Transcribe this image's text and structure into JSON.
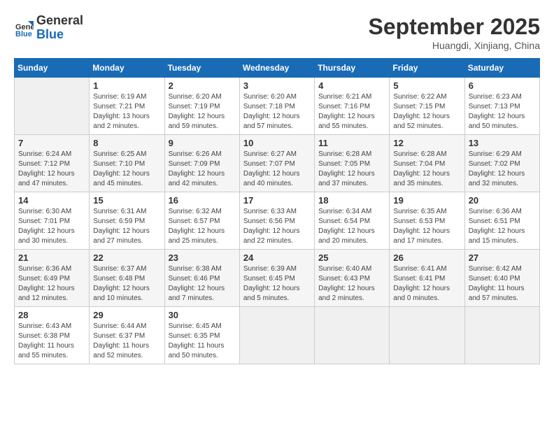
{
  "header": {
    "logo_line1": "General",
    "logo_line2": "Blue",
    "month_title": "September 2025",
    "subtitle": "Huangdi, Xinjiang, China"
  },
  "days_of_week": [
    "Sunday",
    "Monday",
    "Tuesday",
    "Wednesday",
    "Thursday",
    "Friday",
    "Saturday"
  ],
  "weeks": [
    [
      {
        "day": "",
        "empty": true
      },
      {
        "day": "1",
        "sunrise": "Sunrise: 6:19 AM",
        "sunset": "Sunset: 7:21 PM",
        "daylight": "Daylight: 13 hours and 2 minutes."
      },
      {
        "day": "2",
        "sunrise": "Sunrise: 6:20 AM",
        "sunset": "Sunset: 7:19 PM",
        "daylight": "Daylight: 12 hours and 59 minutes."
      },
      {
        "day": "3",
        "sunrise": "Sunrise: 6:20 AM",
        "sunset": "Sunset: 7:18 PM",
        "daylight": "Daylight: 12 hours and 57 minutes."
      },
      {
        "day": "4",
        "sunrise": "Sunrise: 6:21 AM",
        "sunset": "Sunset: 7:16 PM",
        "daylight": "Daylight: 12 hours and 55 minutes."
      },
      {
        "day": "5",
        "sunrise": "Sunrise: 6:22 AM",
        "sunset": "Sunset: 7:15 PM",
        "daylight": "Daylight: 12 hours and 52 minutes."
      },
      {
        "day": "6",
        "sunrise": "Sunrise: 6:23 AM",
        "sunset": "Sunset: 7:13 PM",
        "daylight": "Daylight: 12 hours and 50 minutes."
      }
    ],
    [
      {
        "day": "7",
        "sunrise": "Sunrise: 6:24 AM",
        "sunset": "Sunset: 7:12 PM",
        "daylight": "Daylight: 12 hours and 47 minutes."
      },
      {
        "day": "8",
        "sunrise": "Sunrise: 6:25 AM",
        "sunset": "Sunset: 7:10 PM",
        "daylight": "Daylight: 12 hours and 45 minutes."
      },
      {
        "day": "9",
        "sunrise": "Sunrise: 6:26 AM",
        "sunset": "Sunset: 7:09 PM",
        "daylight": "Daylight: 12 hours and 42 minutes."
      },
      {
        "day": "10",
        "sunrise": "Sunrise: 6:27 AM",
        "sunset": "Sunset: 7:07 PM",
        "daylight": "Daylight: 12 hours and 40 minutes."
      },
      {
        "day": "11",
        "sunrise": "Sunrise: 6:28 AM",
        "sunset": "Sunset: 7:05 PM",
        "daylight": "Daylight: 12 hours and 37 minutes."
      },
      {
        "day": "12",
        "sunrise": "Sunrise: 6:28 AM",
        "sunset": "Sunset: 7:04 PM",
        "daylight": "Daylight: 12 hours and 35 minutes."
      },
      {
        "day": "13",
        "sunrise": "Sunrise: 6:29 AM",
        "sunset": "Sunset: 7:02 PM",
        "daylight": "Daylight: 12 hours and 32 minutes."
      }
    ],
    [
      {
        "day": "14",
        "sunrise": "Sunrise: 6:30 AM",
        "sunset": "Sunset: 7:01 PM",
        "daylight": "Daylight: 12 hours and 30 minutes."
      },
      {
        "day": "15",
        "sunrise": "Sunrise: 6:31 AM",
        "sunset": "Sunset: 6:59 PM",
        "daylight": "Daylight: 12 hours and 27 minutes."
      },
      {
        "day": "16",
        "sunrise": "Sunrise: 6:32 AM",
        "sunset": "Sunset: 6:57 PM",
        "daylight": "Daylight: 12 hours and 25 minutes."
      },
      {
        "day": "17",
        "sunrise": "Sunrise: 6:33 AM",
        "sunset": "Sunset: 6:56 PM",
        "daylight": "Daylight: 12 hours and 22 minutes."
      },
      {
        "day": "18",
        "sunrise": "Sunrise: 6:34 AM",
        "sunset": "Sunset: 6:54 PM",
        "daylight": "Daylight: 12 hours and 20 minutes."
      },
      {
        "day": "19",
        "sunrise": "Sunrise: 6:35 AM",
        "sunset": "Sunset: 6:53 PM",
        "daylight": "Daylight: 12 hours and 17 minutes."
      },
      {
        "day": "20",
        "sunrise": "Sunrise: 6:36 AM",
        "sunset": "Sunset: 6:51 PM",
        "daylight": "Daylight: 12 hours and 15 minutes."
      }
    ],
    [
      {
        "day": "21",
        "sunrise": "Sunrise: 6:36 AM",
        "sunset": "Sunset: 6:49 PM",
        "daylight": "Daylight: 12 hours and 12 minutes."
      },
      {
        "day": "22",
        "sunrise": "Sunrise: 6:37 AM",
        "sunset": "Sunset: 6:48 PM",
        "daylight": "Daylight: 12 hours and 10 minutes."
      },
      {
        "day": "23",
        "sunrise": "Sunrise: 6:38 AM",
        "sunset": "Sunset: 6:46 PM",
        "daylight": "Daylight: 12 hours and 7 minutes."
      },
      {
        "day": "24",
        "sunrise": "Sunrise: 6:39 AM",
        "sunset": "Sunset: 6:45 PM",
        "daylight": "Daylight: 12 hours and 5 minutes."
      },
      {
        "day": "25",
        "sunrise": "Sunrise: 6:40 AM",
        "sunset": "Sunset: 6:43 PM",
        "daylight": "Daylight: 12 hours and 2 minutes."
      },
      {
        "day": "26",
        "sunrise": "Sunrise: 6:41 AM",
        "sunset": "Sunset: 6:41 PM",
        "daylight": "Daylight: 12 hours and 0 minutes."
      },
      {
        "day": "27",
        "sunrise": "Sunrise: 6:42 AM",
        "sunset": "Sunset: 6:40 PM",
        "daylight": "Daylight: 11 hours and 57 minutes."
      }
    ],
    [
      {
        "day": "28",
        "sunrise": "Sunrise: 6:43 AM",
        "sunset": "Sunset: 6:38 PM",
        "daylight": "Daylight: 11 hours and 55 minutes."
      },
      {
        "day": "29",
        "sunrise": "Sunrise: 6:44 AM",
        "sunset": "Sunset: 6:37 PM",
        "daylight": "Daylight: 11 hours and 52 minutes."
      },
      {
        "day": "30",
        "sunrise": "Sunrise: 6:45 AM",
        "sunset": "Sunset: 6:35 PM",
        "daylight": "Daylight: 11 hours and 50 minutes."
      },
      {
        "day": "",
        "empty": true
      },
      {
        "day": "",
        "empty": true
      },
      {
        "day": "",
        "empty": true
      },
      {
        "day": "",
        "empty": true
      }
    ]
  ]
}
